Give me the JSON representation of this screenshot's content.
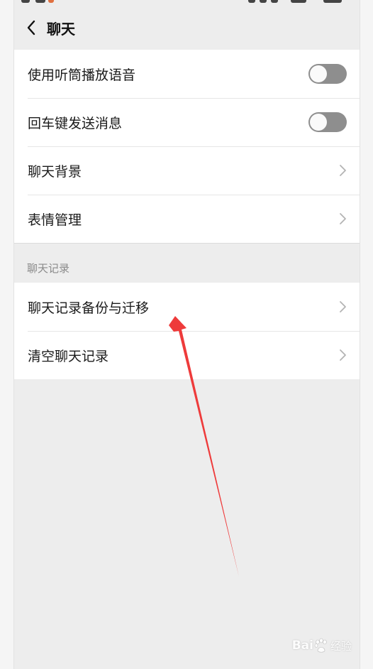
{
  "header": {
    "title": "聊天"
  },
  "settings": {
    "rows": [
      {
        "label": "使用听筒播放语音",
        "control": "toggle",
        "on": false
      },
      {
        "label": "回车键发送消息",
        "control": "toggle",
        "on": false
      },
      {
        "label": "聊天背景",
        "control": "chevron"
      },
      {
        "label": "表情管理",
        "control": "chevron"
      }
    ]
  },
  "history": {
    "section_title": "聊天记录",
    "rows": [
      {
        "label": "聊天记录备份与迁移",
        "control": "chevron"
      },
      {
        "label": "清空聊天记录",
        "control": "chevron"
      }
    ]
  },
  "annotation": {
    "arrow_color": "#ee3b3b"
  },
  "watermark": {
    "text": "Bai",
    "suffix": "经验"
  },
  "colors": {
    "background": "#ededed",
    "card": "#ffffff",
    "toggle_off": "#8e8e8e",
    "section_text": "#8a8a8a"
  }
}
